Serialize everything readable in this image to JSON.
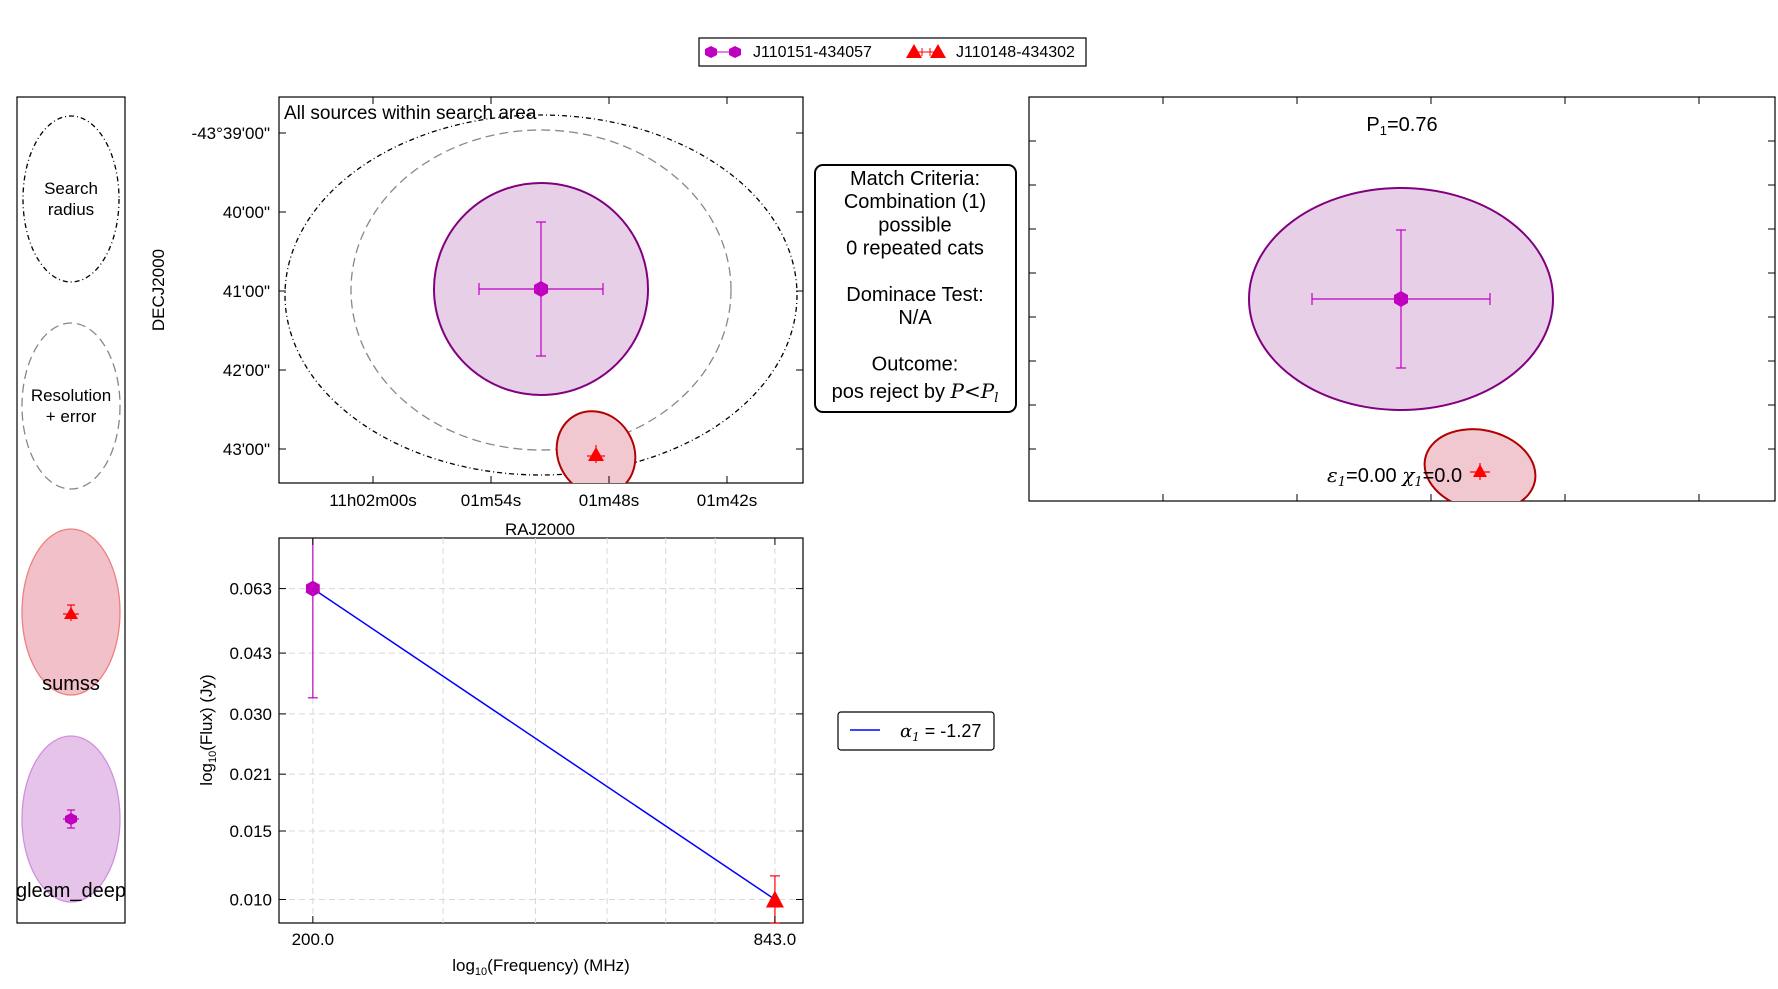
{
  "colors": {
    "gleam_edge": "#800080",
    "gleam_fill": "#e8cfe8",
    "gleam_marker": "#c000c0",
    "sumss_edge": "#b00000",
    "sumss_fill": "#f2c8d0",
    "sumss_marker": "#ff0000",
    "fit_line": "#0000ff"
  },
  "legend_top": {
    "entries": [
      {
        "label": "J110151-434057",
        "marker": "hexagon"
      },
      {
        "label": "J110148-434302",
        "marker": "triangle"
      }
    ]
  },
  "key_panel": {
    "search_radius_label": [
      "Search",
      "radius"
    ],
    "resolution_label": [
      "Resolution",
      "+ error"
    ],
    "sumss_label": "sumss",
    "gleam_label": "gleam_deep"
  },
  "info_box": {
    "lines": [
      "Match Criteria:",
      "Combination (1)",
      "possible",
      "0 repeated cats",
      "",
      "Dominace Test:",
      "N/A",
      "",
      "Outcome:"
    ],
    "outcome_text": "pos reject by",
    "outcome_math": "P<P",
    "outcome_sub": "l"
  },
  "chart_data": [
    {
      "type": "scatter",
      "title": "All sources within search area",
      "xlabel": "RAJ2000",
      "ylabel": "DECJ2000",
      "xticks": [
        "11h02m00s",
        "01m54s",
        "01m48s",
        "01m42s"
      ],
      "yticks": [
        "-43°39'00\"",
        "40'00\"",
        "41'00\"",
        "42'00\"",
        "43'00\""
      ],
      "sources": [
        {
          "name": "J110151-434057",
          "ra": "11h01m51s",
          "dec": "-43°40'57\""
        },
        {
          "name": "J110148-434302",
          "ra": "11h01m48s",
          "dec": "-43°43'02\""
        }
      ]
    },
    {
      "type": "line",
      "xlabel": "log10(Frequency) (MHz)",
      "ylabel": "log10(Flux) (Jy)",
      "xticks": [
        "200.0",
        "843.0"
      ],
      "yticks": [
        "0.063",
        "0.043",
        "0.030",
        "0.021",
        "0.015",
        "0.010"
      ],
      "x": [
        200.0,
        843.0
      ],
      "series": [
        {
          "name": "gleam_deep",
          "points": [
            {
              "x": 200.0,
              "y": 0.063,
              "y_low": 0.033,
              "y_high": 0.12
            }
          ]
        },
        {
          "name": "sumss",
          "points": [
            {
              "x": 843.0,
              "y": 0.01,
              "y_low": 0.0085,
              "y_high": 0.0115
            }
          ]
        }
      ],
      "fit": {
        "label_math": "α",
        "label_sub": "1",
        "label_value": " = -1.27",
        "alpha": -1.27
      }
    },
    {
      "type": "scatter",
      "title_text": "P",
      "title_sub": "1",
      "title_value": "=0.76",
      "stat_eps": "ε",
      "stat_eps_sub": "1",
      "stat_eps_value": "=0.00",
      "stat_chi": "χ",
      "stat_chi_sub": "1",
      "stat_chi_value": "=0.0"
    }
  ]
}
